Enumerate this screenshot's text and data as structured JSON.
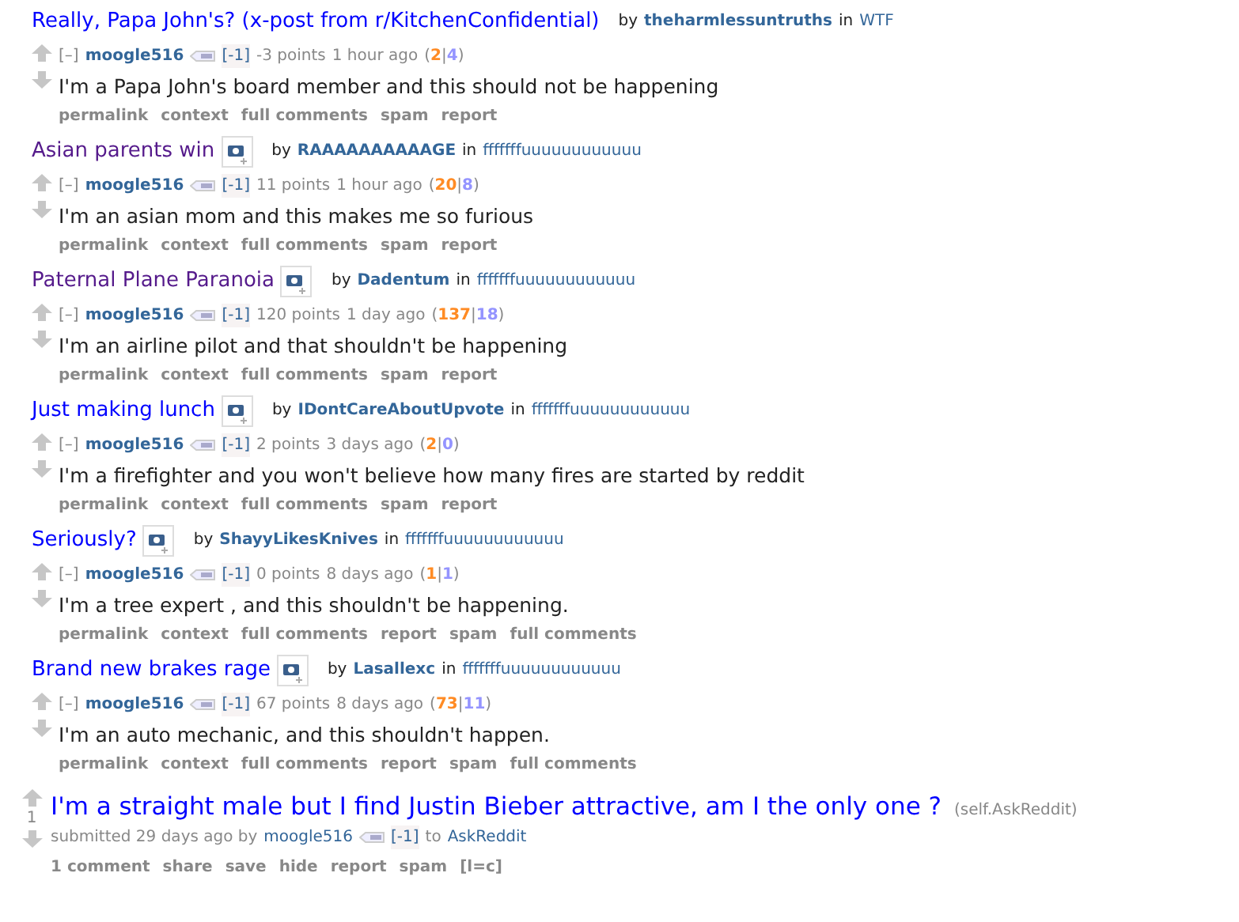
{
  "entries": [
    {
      "title": "Really, Papa John's? (x-post from r/KitchenConfidential)",
      "visited": false,
      "thumbnail": false,
      "by_word": "by",
      "by": "theharmlessuntruths",
      "in_word": "in",
      "subreddit": "WTF",
      "collapse": "[–]",
      "author": "moogle516",
      "flair": "[-1]",
      "score": "-3 points",
      "time": "1 hour ago",
      "vote_marks": [
        "(",
        "|",
        ")"
      ],
      "ups": "2",
      "downs": "4",
      "body": "I'm a Papa John's board member and this should not be happening",
      "actions": [
        "permalink",
        "context",
        "full comments",
        "spam",
        "report"
      ]
    },
    {
      "title": "Asian parents win",
      "visited": true,
      "thumbnail": true,
      "by_word": "by",
      "by": "RAAAAAAAAAAGE",
      "in_word": "in",
      "subreddit": "fffffffuuuuuuuuuuuu",
      "collapse": "[–]",
      "author": "moogle516",
      "flair": "[-1]",
      "score": "11 points",
      "time": "1 hour ago",
      "vote_marks": [
        "(",
        "|",
        ")"
      ],
      "ups": "20",
      "downs": "8",
      "body": "I'm an asian mom and this makes me so furious",
      "actions": [
        "permalink",
        "context",
        "full comments",
        "spam",
        "report"
      ]
    },
    {
      "title": "Paternal Plane Paranoia",
      "visited": true,
      "thumbnail": true,
      "by_word": "by",
      "by": "Dadentum",
      "in_word": "in",
      "subreddit": "fffffffuuuuuuuuuuuu",
      "collapse": "[–]",
      "author": "moogle516",
      "flair": "[-1]",
      "score": "120 points",
      "time": "1 day ago",
      "vote_marks": [
        "(",
        "|",
        ")"
      ],
      "ups": "137",
      "downs": "18",
      "body": "I'm an airline pilot and that shouldn't be happening",
      "actions": [
        "permalink",
        "context",
        "full comments",
        "spam",
        "report"
      ]
    },
    {
      "title": "Just making lunch",
      "visited": false,
      "thumbnail": true,
      "by_word": "by",
      "by": "IDontCareAboutUpvote",
      "in_word": "in",
      "subreddit": "fffffffuuuuuuuuuuuu",
      "collapse": "[–]",
      "author": "moogle516",
      "flair": "[-1]",
      "score": "2 points",
      "time": "3 days ago",
      "vote_marks": [
        "(",
        "|",
        ")"
      ],
      "ups": "2",
      "downs": "0",
      "body": "I'm a firefighter and you won't believe how many fires are started by reddit",
      "actions": [
        "permalink",
        "context",
        "full comments",
        "spam",
        "report"
      ]
    },
    {
      "title": "Seriously?",
      "visited": false,
      "thumbnail": true,
      "by_word": "by",
      "by": "ShayyLikesKnives",
      "in_word": "in",
      "subreddit": "fffffffuuuuuuuuuuuu",
      "collapse": "[–]",
      "author": "moogle516",
      "flair": "[-1]",
      "score": "0 points",
      "time": "8 days ago",
      "vote_marks": [
        "(",
        "|",
        ")"
      ],
      "ups": "1",
      "downs": "1",
      "body": "I'm a tree expert , and this shouldn't be happening.",
      "actions": [
        "permalink",
        "context",
        "full comments",
        "report",
        "spam",
        "full comments"
      ]
    },
    {
      "title": "Brand new brakes rage",
      "visited": false,
      "thumbnail": true,
      "by_word": "by",
      "by": "Lasallexc",
      "in_word": "in",
      "subreddit": "fffffffuuuuuuuuuuuu",
      "collapse": "[–]",
      "author": "moogle516",
      "flair": "[-1]",
      "score": "67 points",
      "time": "8 days ago",
      "vote_marks": [
        "(",
        "|",
        ")"
      ],
      "ups": "73",
      "downs": "11",
      "body": "I'm an auto mechanic, and this shouldn't happen.",
      "actions": [
        "permalink",
        "context",
        "full comments",
        "report",
        "spam",
        "full comments"
      ]
    }
  ],
  "post": {
    "title": "I'm a straight male but I find Justin Bieber attractive, am I the only one ?",
    "domain": "(self.AskReddit)",
    "score": "1",
    "submitted": "submitted 29 days ago by",
    "author": "moogle516",
    "flair": "[-1]",
    "to_word": "to",
    "subreddit": "AskReddit",
    "actions": [
      "1 comment",
      "share",
      "save",
      "hide",
      "report",
      "spam",
      "[l=c]"
    ]
  }
}
